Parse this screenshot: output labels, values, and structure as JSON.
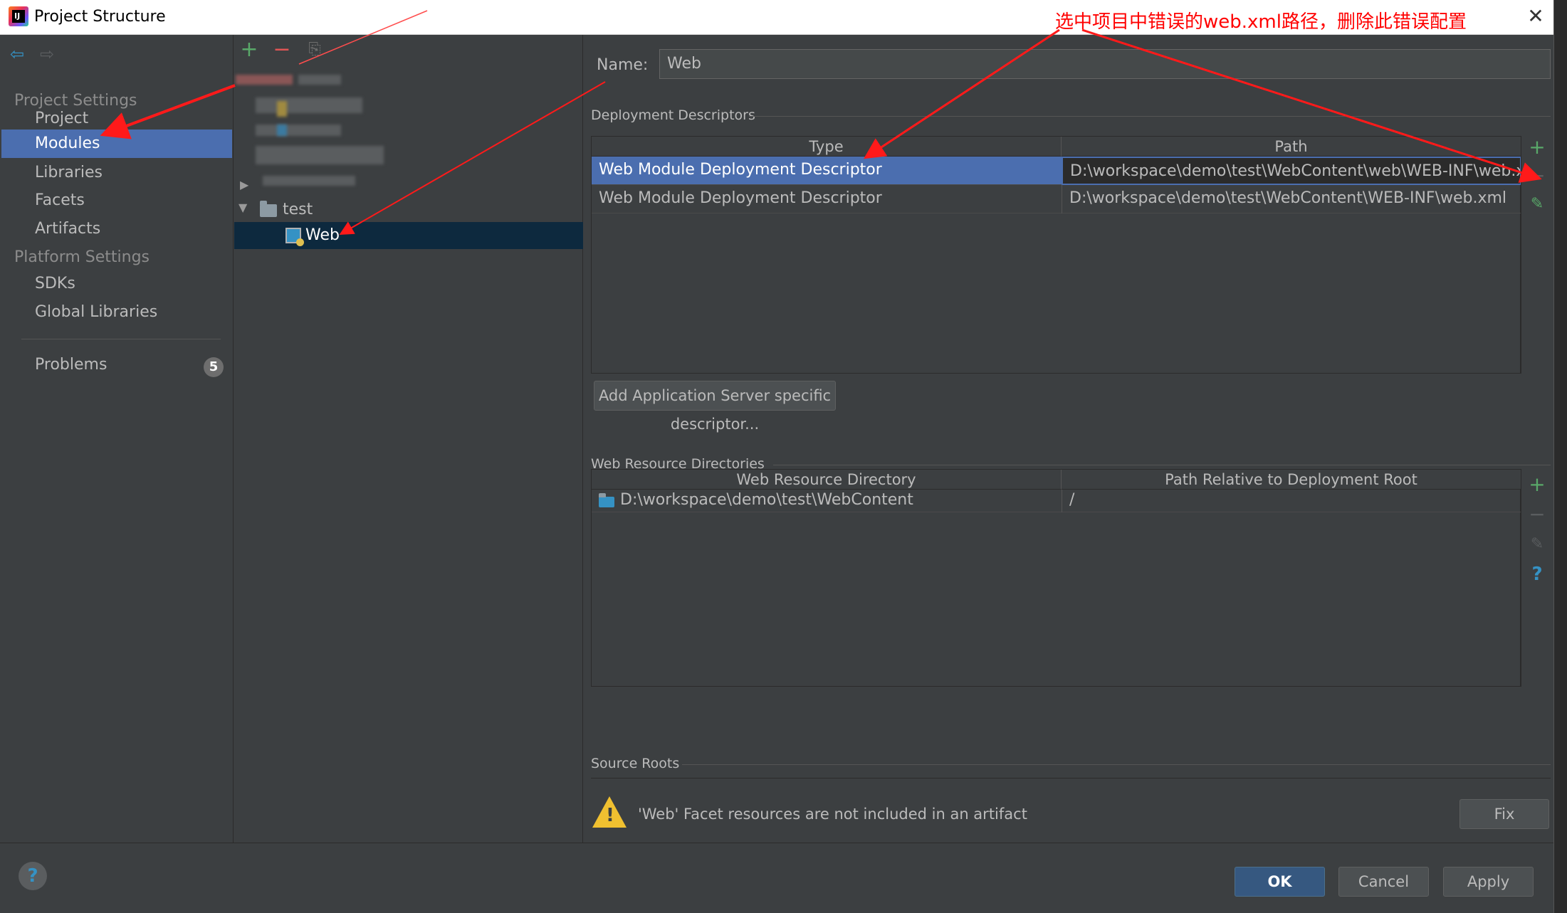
{
  "window": {
    "title": "Project Structure",
    "annotation": "选中项目中错误的web.xml路径，删除此错误配置",
    "close_glyph": "✕",
    "app_icon_text": "IJ"
  },
  "nav": {
    "back_glyph": "⇦",
    "forward_glyph": "⇨",
    "project_settings_heading": "Project Settings",
    "project_settings_items": [
      "Project",
      "Modules",
      "Libraries",
      "Facets",
      "Artifacts"
    ],
    "platform_settings_heading": "Platform Settings",
    "platform_settings_items": [
      "SDKs",
      "Global Libraries"
    ],
    "problems_label": "Problems",
    "problems_count": "5",
    "selected": "Modules"
  },
  "tree": {
    "add_glyph": "+",
    "remove_glyph": "−",
    "copy_glyph": "⎘",
    "expander_closed": "▶",
    "expander_open": "▼",
    "nodes": [
      {
        "label": "test"
      },
      {
        "label": "Web"
      }
    ]
  },
  "content": {
    "name_label": "Name:",
    "name_value": "Web",
    "deployment_section": "Deployment Descriptors",
    "deployment_columns": [
      "Type",
      "Path"
    ],
    "deployment_rows": [
      {
        "type": "Web Module Deployment Descriptor",
        "path": "D:\\workspace\\demo\\test\\WebContent\\web\\WEB-INF\\web.xml"
      },
      {
        "type": "Web Module Deployment Descriptor",
        "path": "D:\\workspace\\demo\\test\\WebContent\\WEB-INF\\web.xml"
      }
    ],
    "add_server_descriptor_button": "Add Application Server specific descriptor...",
    "resource_section": "Web Resource Directories",
    "resource_columns": [
      "Web Resource Directory",
      "Path Relative to Deployment Root"
    ],
    "resource_rows": [
      {
        "directory": "D:\\workspace\\demo\\test\\WebContent",
        "relative": "/"
      }
    ],
    "source_roots_section": "Source Roots",
    "warning_text": "'Web' Facet resources are not included in an artifact",
    "fix_button": "Fix",
    "side_add_glyph": "+",
    "side_remove_glyph": "−",
    "side_edit_glyph": "✎",
    "side_help_glyph": "?"
  },
  "footer": {
    "help_glyph": "?",
    "ok": "OK",
    "cancel": "Cancel",
    "apply": "Apply"
  },
  "colors": {
    "background": "#3c3f41",
    "selection": "#4b6eaf",
    "tree_selection": "#0d293e",
    "annotation": "#ff0000",
    "add": "#59a869",
    "remove": "#e05555",
    "primary_button": "#365880",
    "warning": "#f0c030"
  }
}
